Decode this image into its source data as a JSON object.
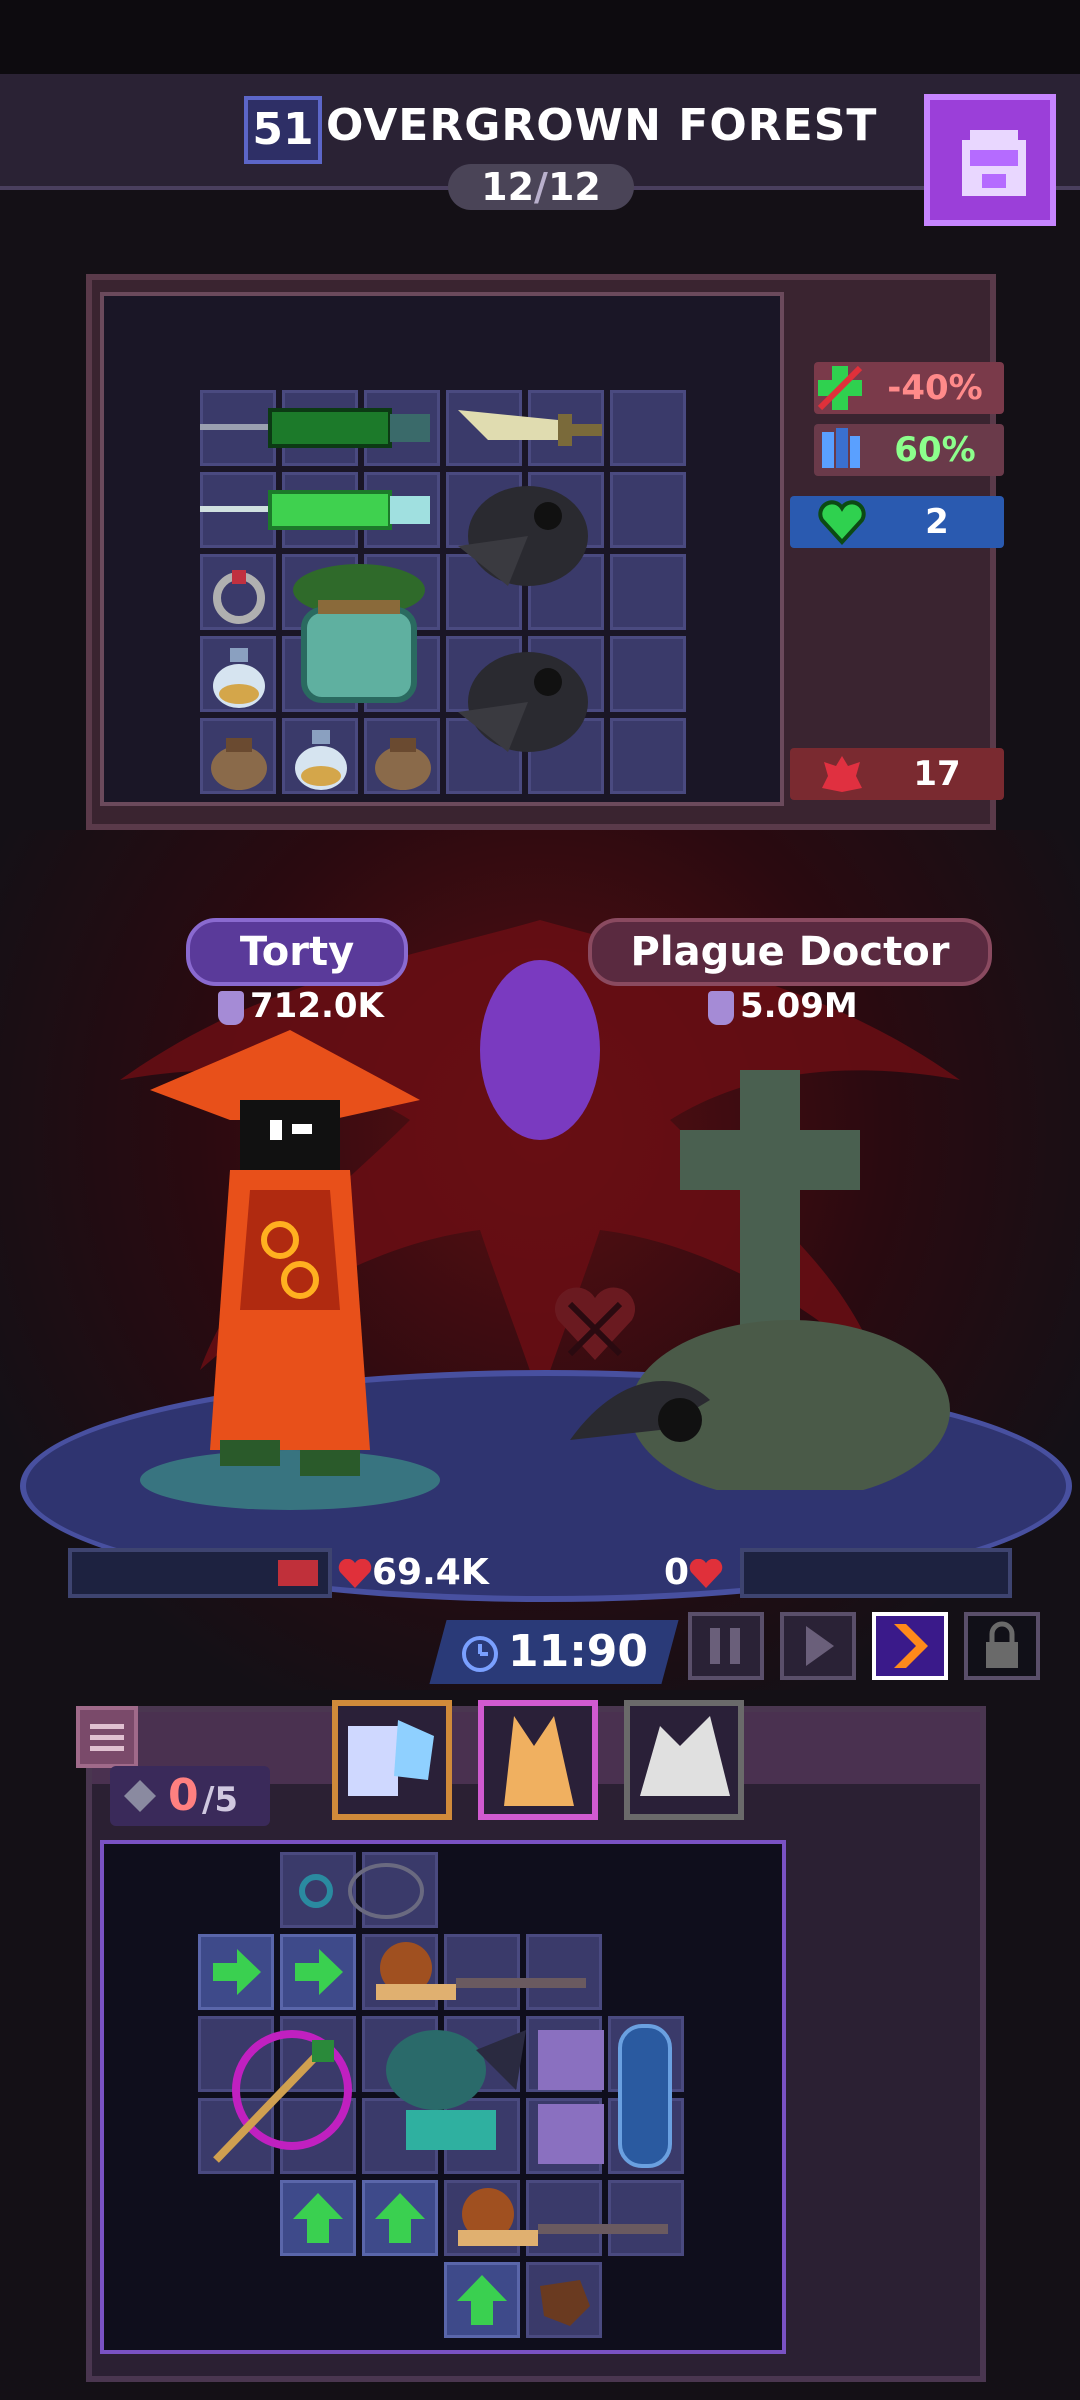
{
  "header": {
    "stage_number": "51",
    "stage_name": "OVERGROWN FOREST",
    "wave_current": "12",
    "wave_total": "12",
    "backpack_icon": "backpack-icon"
  },
  "enemy_stats": [
    {
      "icon": "healing-reduced-icon",
      "value": "-40%",
      "color": "#ff8a8a"
    },
    {
      "icon": "armor-icon",
      "value": "60%",
      "color": "#8cff8c"
    },
    {
      "icon": "heart-shield-icon",
      "value": "2",
      "color": "#ffffff"
    },
    {
      "icon": "rage-icon",
      "value": "17",
      "color": "#ffffff"
    }
  ],
  "player": {
    "name": "Torty",
    "power": "712.0K",
    "hp": "69.4K"
  },
  "enemy": {
    "name": "Plague Doctor",
    "power": "5.09M",
    "hp": "0"
  },
  "battle": {
    "timer": "11:90",
    "controls": [
      "pause-icon",
      "play-icon",
      "fast-forward-icon",
      "lock-icon"
    ]
  },
  "bag": {
    "gems_current": "0",
    "gems_total": "/5",
    "portraits": [
      "ice-crystal-pet",
      "orange-cat-pet",
      "white-wolf-pet"
    ]
  },
  "colors": {
    "accent_purple": "#9b3fd9",
    "player_plate": "#5a3a9a",
    "enemy_plate": "#5a2a40",
    "hp_red": "#e0303a"
  }
}
